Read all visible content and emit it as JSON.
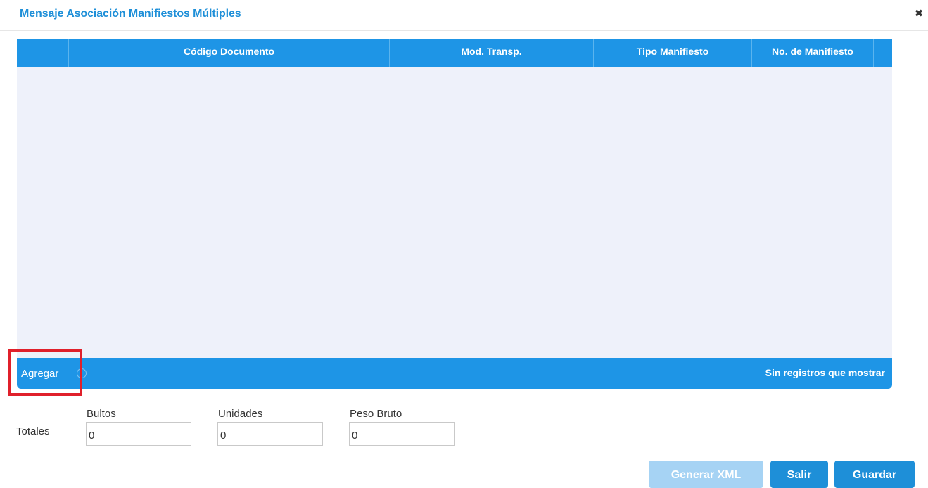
{
  "dialog": {
    "title": "Mensaje Asociación Manifiestos Múltiples",
    "close_icon": "close-icon"
  },
  "grid": {
    "columns": [
      "",
      "Código Documento",
      "Mod. Transp.",
      "Tipo Manifiesto",
      "No. de Manifiesto"
    ],
    "rows": [],
    "footer": {
      "add_label": "Agregar",
      "add_icon": "add-circle-icon",
      "status_text": "Sin registros que mostrar"
    }
  },
  "totals": {
    "label": "Totales",
    "fields": [
      {
        "label": "Bultos",
        "value": "0"
      },
      {
        "label": "Unidades",
        "value": "0"
      },
      {
        "label": "Peso Bruto",
        "value": "0"
      }
    ]
  },
  "actions": {
    "generate_xml": "Generar XML",
    "exit": "Salir",
    "save": "Guardar"
  },
  "colors": {
    "accent": "#1e95e6",
    "title": "#1e8fd8",
    "grid_body": "#eef1fa",
    "disabled_button": "#a6d3f4",
    "highlight": "#e0202b"
  }
}
